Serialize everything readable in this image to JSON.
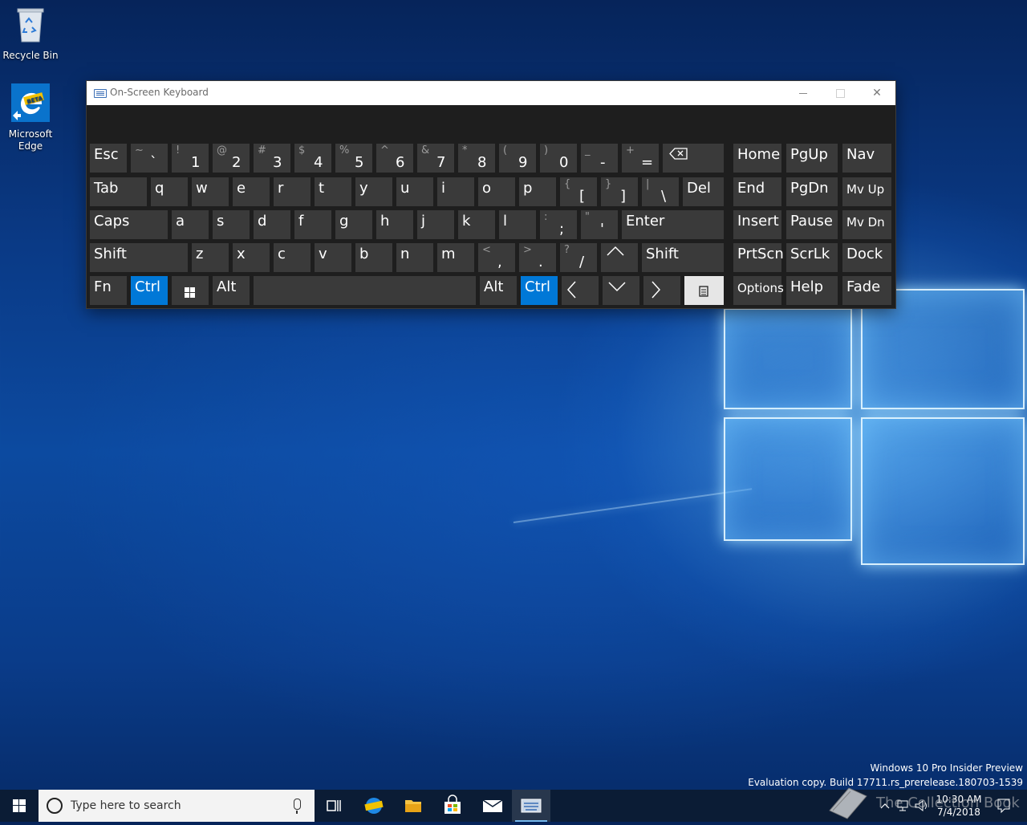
{
  "desktop": {
    "icons": [
      {
        "label": "Recycle Bin",
        "icon": "recycle-bin-icon"
      },
      {
        "label": "Microsoft Edge",
        "icon": "edge-beta-icon"
      }
    ],
    "build_line1": "Windows 10 Pro Insider Preview",
    "build_line2": "Evaluation copy. Build 17711.rs_prerelease.180703-1539"
  },
  "osk": {
    "title": "On-Screen Keyboard",
    "controls": {
      "minimize": "minimize-icon",
      "maximize": "maximize-icon",
      "close": "close-icon"
    },
    "keys": {
      "esc": "Esc",
      "tab": "Tab",
      "caps": "Caps",
      "shift_l": "Shift",
      "fn": "Fn",
      "ctrl_l": "Ctrl",
      "alt_l": "Alt",
      "del": "Del",
      "enter": "Enter",
      "shift_r": "Shift",
      "alt_r": "Alt",
      "ctrl_r": "Ctrl",
      "home": "Home",
      "pgup": "PgUp",
      "nav": "Nav",
      "end": "End",
      "pgdn": "PgDn",
      "mvup": "Mv Up",
      "insert": "Insert",
      "pause": "Pause",
      "mvdn": "Mv Dn",
      "prtscn": "PrtScn",
      "scrlk": "ScrLk",
      "dock": "Dock",
      "options": "Options",
      "help": "Help",
      "fade": "Fade"
    },
    "row1": [
      {
        "hi": "~",
        "lo": "`"
      },
      {
        "hi": "!",
        "lo": "1"
      },
      {
        "hi": "@",
        "lo": "2"
      },
      {
        "hi": "#",
        "lo": "3"
      },
      {
        "hi": "$",
        "lo": "4"
      },
      {
        "hi": "%",
        "lo": "5"
      },
      {
        "hi": "^",
        "lo": "6"
      },
      {
        "hi": "&",
        "lo": "7"
      },
      {
        "hi": "*",
        "lo": "8"
      },
      {
        "hi": "(",
        "lo": "9"
      },
      {
        "hi": ")",
        "lo": "0"
      },
      {
        "hi": "_",
        "lo": "-"
      },
      {
        "hi": "+",
        "lo": "="
      }
    ],
    "row2": [
      "q",
      "w",
      "e",
      "r",
      "t",
      "y",
      "u",
      "i",
      "o",
      "p"
    ],
    "row2_sym": [
      {
        "hi": "{",
        "lo": "["
      },
      {
        "hi": "}",
        "lo": "]"
      },
      {
        "hi": "|",
        "lo": "\\"
      }
    ],
    "row3": [
      "a",
      "s",
      "d",
      "f",
      "g",
      "h",
      "j",
      "k",
      "l"
    ],
    "row3_sym": [
      {
        "hi": ":",
        "lo": ";"
      },
      {
        "hi": "\"",
        "lo": "'"
      }
    ],
    "row4": [
      "z",
      "x",
      "c",
      "v",
      "b",
      "n",
      "m"
    ],
    "row4_sym": [
      {
        "hi": "<",
        "lo": ","
      },
      {
        "hi": ">",
        "lo": "."
      },
      {
        "hi": "?",
        "lo": "/"
      }
    ]
  },
  "taskbar": {
    "search_placeholder": "Type here to search",
    "time": "10:30 AM",
    "date": "7/4/2018",
    "watermark": "The Collection Book"
  }
}
